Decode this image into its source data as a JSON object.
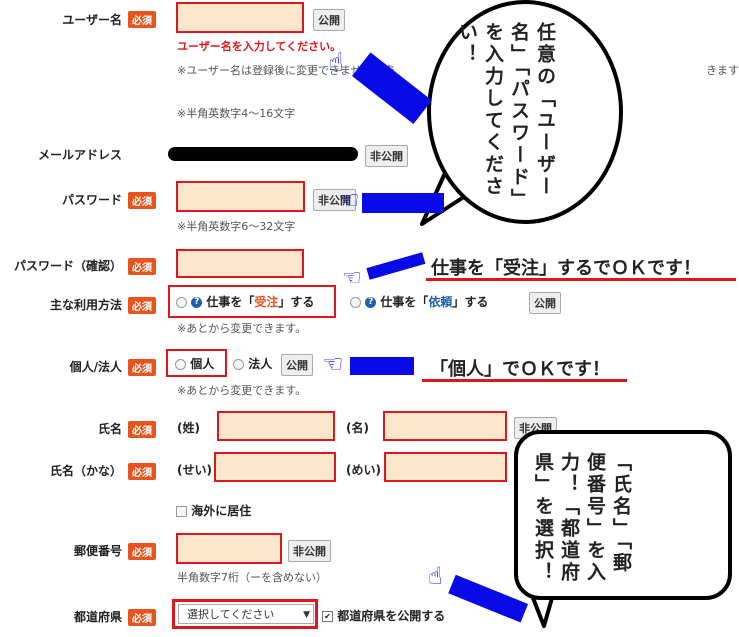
{
  "form": {
    "required_badge": "必須",
    "public_label": "公開",
    "private_label": "非公開",
    "username": {
      "label": "ユーザー名",
      "error": "ユーザー名を入力してください。",
      "note1": "※ユーザー名は登録後に変更できません。表",
      "note1_tail": "きます",
      "note2": "※半角英数字4〜16文字"
    },
    "email": {
      "label": "メールアドレス"
    },
    "password": {
      "label": "パスワード",
      "note": "※半角英数字6〜32文字"
    },
    "password_confirm": {
      "label": "パスワード（確認）"
    },
    "usage": {
      "label": "主な利用方法",
      "option1_pre": "仕事を「",
      "option1_em": "受注",
      "option1_post": "」する",
      "option2_pre": "仕事を「",
      "option2_em": "依頼",
      "option2_post": "」する",
      "note": "※あとから変更できます。",
      "help_glyph": "?"
    },
    "entity": {
      "label": "個人/法人",
      "option1": "個人",
      "option2": "法人",
      "note": "※あとから変更できます。"
    },
    "name": {
      "label": "氏名",
      "last_prefix": "(姓)",
      "first_prefix": "(名)"
    },
    "name_kana": {
      "label": "氏名（かな）",
      "last_prefix": "(せい)",
      "first_prefix": "(めい)"
    },
    "abroad": {
      "label": "海外に居住"
    },
    "postal": {
      "label": "郵便番号",
      "note": "半角数字7桁（ーを含めない）"
    },
    "prefecture": {
      "label": "都道府県",
      "select_value": "選択してください",
      "checkbox_label": "都道府県を公開する",
      "checked": true
    }
  },
  "annotations": {
    "bubble1": "任意の「ユーザー名」「パスワード」を入力してください！",
    "bubble2": "「氏名」「郵便番号」を入力！「都道府県」を選択！",
    "callout_order": "仕事を「受注」するでＯＫです！",
    "callout_individual": "「個人」でＯＫです！"
  },
  "colors": {
    "required_bg": "#e8541e",
    "input_bg": "#fde6cc",
    "highlight_border": "#e0161e",
    "accent_orange": "#e8541e",
    "accent_blue": "#1e5fa8",
    "pointer_bar": "#0a0ae6"
  }
}
